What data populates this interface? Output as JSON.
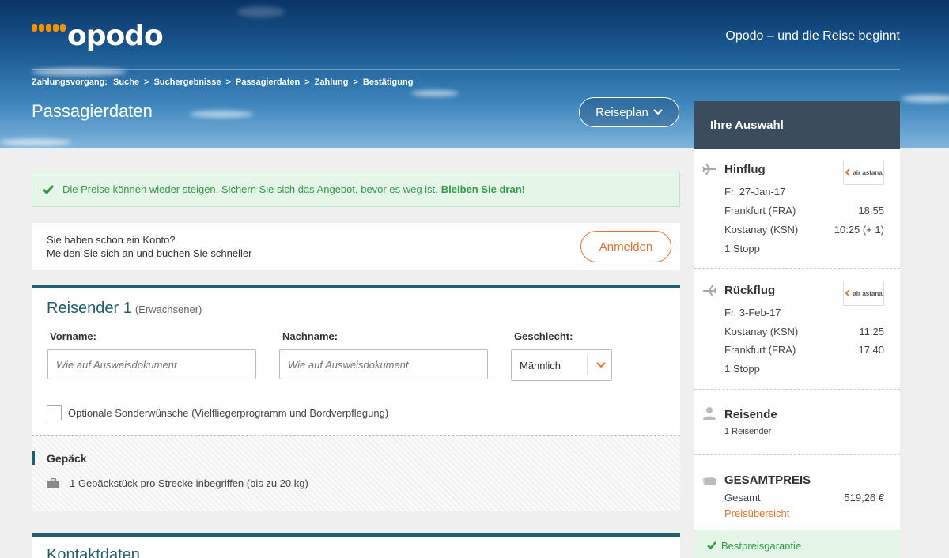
{
  "header": {
    "logo_text": "opodo",
    "tagline": "Opodo – und die Reise beginnt",
    "breadcrumb": {
      "prefix": "Zahlungsvorgang:",
      "steps": [
        "Suche",
        "Suchergebnisse",
        "Passagierdaten",
        "Zahlung",
        "Bestätigung"
      ],
      "separator": ">"
    },
    "page_title": "Passagierdaten",
    "reiseplan_label": "Reiseplan"
  },
  "alert": {
    "text": "Die Preise können wieder steigen. Sichern Sie sich das Angebot, bevor es weg ist.",
    "highlight": "Bleiben Sie dran!"
  },
  "login": {
    "line1": "Sie haben schon ein Konto?",
    "line2": "Melden Sie sich an und buchen Sie schneller",
    "button_label": "Anmelden"
  },
  "traveler": {
    "title": "Reisender 1",
    "subtitle": "(Erwachsener)",
    "first_name_label": "Vorname:",
    "first_name_placeholder": "Wie auf Ausweisdokument",
    "last_name_label": "Nachname:",
    "last_name_placeholder": "Wie auf Ausweisdokument",
    "gender_label": "Geschlecht:",
    "gender_value": "Männlich",
    "optional_label": "Optionale Sonderwünsche (Vielfliegerprogramm und Bordverpflegung)",
    "baggage_title": "Gepäck",
    "baggage_text": "1 Gepäckstück pro Strecke inbegriffen (bis zu 20 kg)"
  },
  "contact": {
    "title": "Kontaktdaten"
  },
  "sidebar": {
    "title": "Ihre Auswahl",
    "outbound": {
      "title": "Hinflug",
      "date": "Fr, 27-Jan-17",
      "from": "Frankfurt (FRA)",
      "from_time": "18:55",
      "to": "Kostanay (KSN)",
      "to_time": "10:25 (+ 1)",
      "stops": "1 Stopp",
      "airline": "air astana"
    },
    "return": {
      "title": "Rückflug",
      "date": "Fr, 3-Feb-17",
      "from": "Kostanay (KSN)",
      "from_time": "11:25",
      "to": "Frankfurt (FRA)",
      "to_time": "17:40",
      "stops": "1 Stopp",
      "airline": "air astana"
    },
    "travelers": {
      "title": "Reisende",
      "count": "1 Reisender"
    },
    "total": {
      "title": "GESAMTPREIS",
      "label": "Gesamt",
      "value": "519,26 €",
      "link": "Preisübersicht"
    },
    "guarantee": "Bestpreisgarantie"
  },
  "colors": {
    "accent_orange": "#e8712a",
    "teal": "#1f6070",
    "success_green": "#2f9d44",
    "sidebar_header": "#3b4d5c"
  }
}
